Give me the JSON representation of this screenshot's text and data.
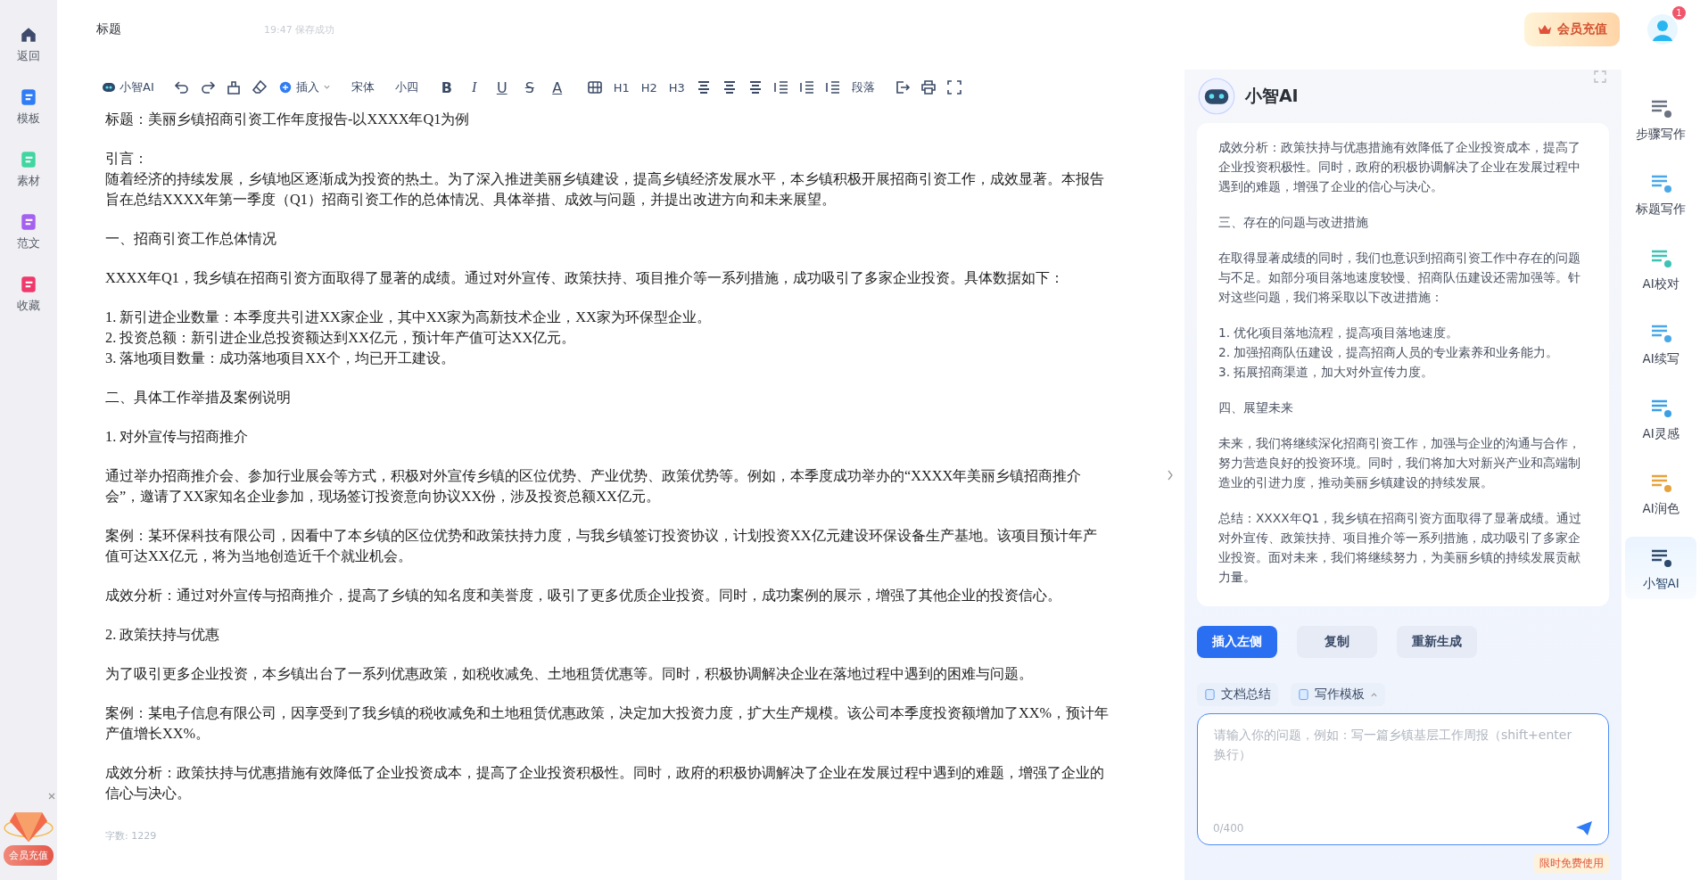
{
  "top_bar": {
    "title": "标题",
    "save_status": "19:47 保存成功",
    "vip_button": "会员充值",
    "notification_count": "1"
  },
  "sidebar": {
    "items": [
      {
        "label": "返回"
      },
      {
        "label": "模板"
      },
      {
        "label": "素材"
      },
      {
        "label": "范文"
      },
      {
        "label": "收藏"
      }
    ],
    "promo_button": "会员充值"
  },
  "toolbar": {
    "ai_label": "小智AI",
    "insert": "插入",
    "font": "宋体",
    "size": "小四",
    "format": [
      "B",
      "I",
      "U",
      "S",
      "A"
    ],
    "headings": [
      "H1",
      "H2",
      "H3"
    ],
    "paragraph": "段落"
  },
  "document": {
    "blocks": [
      [
        "标题：美丽乡镇招商引资工作年度报告-以XXXX年Q1为例"
      ],
      [
        "引言：",
        "随着经济的持续发展，乡镇地区逐渐成为投资的热土。为了深入推进美丽乡镇建设，提高乡镇经济发展水平，本乡镇积极开展招商引资工作，成效显著。本报告旨在总结XXXX年第一季度（Q1）招商引资工作的总体情况、具体举措、成效与问题，并提出改进方向和未来展望。"
      ],
      [
        "一、招商引资工作总体情况"
      ],
      [
        "XXXX年Q1，我乡镇在招商引资方面取得了显著的成绩。通过对外宣传、政策扶持、项目推介等一系列措施，成功吸引了多家企业投资。具体数据如下："
      ],
      [
        "1. 新引进企业数量：本季度共引进XX家企业，其中XX家为高新技术企业，XX家为环保型企业。",
        "2. 投资总额：新引进企业总投资额达到XX亿元，预计年产值可达XX亿元。",
        "3. 落地项目数量：成功落地项目XX个，均已开工建设。"
      ],
      [
        "二、具体工作举措及案例说明"
      ],
      [
        "1. 对外宣传与招商推介"
      ],
      [
        "通过举办招商推介会、参加行业展会等方式，积极对外宣传乡镇的区位优势、产业优势、政策优势等。例如，本季度成功举办的“XXXX年美丽乡镇招商推介会”，邀请了XX家知名企业参加，现场签订投资意向协议XX份，涉及投资总额XX亿元。"
      ],
      [
        "案例：某环保科技有限公司，因看中了本乡镇的区位优势和政策扶持力度，与我乡镇签订投资协议，计划投资XX亿元建设环保设备生产基地。该项目预计年产值可达XX亿元，将为当地创造近千个就业机会。"
      ],
      [
        "成效分析：通过对外宣传与招商推介，提高了乡镇的知名度和美誉度，吸引了更多优质企业投资。同时，成功案例的展示，增强了其他企业的投资信心。"
      ],
      [
        "2. 政策扶持与优惠"
      ],
      [
        "为了吸引更多企业投资，本乡镇出台了一系列优惠政策，如税收减免、土地租赁优惠等。同时，积极协调解决企业在落地过程中遇到的困难与问题。"
      ],
      [
        "案例：某电子信息有限公司，因享受到了我乡镇的税收减免和土地租赁优惠政策，决定加大投资力度，扩大生产规模。该公司本季度投资额增加了XX%，预计年产值增长XX%。"
      ],
      [
        "成效分析：政策扶持与优惠措施有效降低了企业投资成本，提高了企业投资积极性。同时，政府的积极协调解决了企业在发展过程中遇到的难题，增强了企业的信心与决心。"
      ]
    ],
    "word_count": "字数: 1229"
  },
  "ai_panel": {
    "title": "小智AI",
    "blocks": [
      [
        "成效分析：政策扶持与优惠措施有效降低了企业投资成本，提高了企业投资积极性。同时，政府的积极协调解决了企业在发展过程中遇到的难题，增强了企业的信心与决心。"
      ],
      [
        "三、存在的问题与改进措施"
      ],
      [
        "在取得显著成绩的同时，我们也意识到招商引资工作中存在的问题与不足。如部分项目落地速度较慢、招商队伍建设还需加强等。针对这些问题，我们将采取以下改进措施："
      ],
      [
        "1. 优化项目落地流程，提高项目落地速度。",
        "2. 加强招商队伍建设，提高招商人员的专业素养和业务能力。",
        "3. 拓展招商渠道，加大对外宣传力度。"
      ],
      [
        "四、展望未来"
      ],
      [
        "未来，我们将继续深化招商引资工作，加强与企业的沟通与合作，努力营造良好的投资环境。同时，我们将加大对新兴产业和高端制造业的引进力度，推动美丽乡镇建设的持续发展。"
      ],
      [
        "总结：XXXX年Q1，我乡镇在招商引资方面取得了显著成绩。通过对外宣传、政策扶持、项目推介等一系列措施，成功吸引了多家企业投资。面对未来，我们将继续努力，为美丽乡镇的持续发展贡献力量。"
      ]
    ],
    "actions": [
      {
        "label": "插入左侧",
        "kind": "primary"
      },
      {
        "label": "复制",
        "kind": "secondary"
      },
      {
        "label": "重新生成",
        "kind": "secondary"
      }
    ],
    "chips": [
      "文档总结",
      "写作模板"
    ],
    "input": {
      "placeholder": "请输入你的问题，例如：写一篇乡镇基层工作周报（shift+enter换行）",
      "counter": "0/400"
    },
    "tag": "限时免费使用"
  },
  "tool_rail": [
    {
      "label": "步骤写作",
      "selected": false
    },
    {
      "label": "标题写作",
      "selected": false
    },
    {
      "label": "AI校对",
      "selected": false
    },
    {
      "label": "AI续写",
      "selected": false
    },
    {
      "label": "AI灵感",
      "selected": false
    },
    {
      "label": "AI润色",
      "selected": false
    },
    {
      "label": "小智AI",
      "selected": true
    }
  ]
}
